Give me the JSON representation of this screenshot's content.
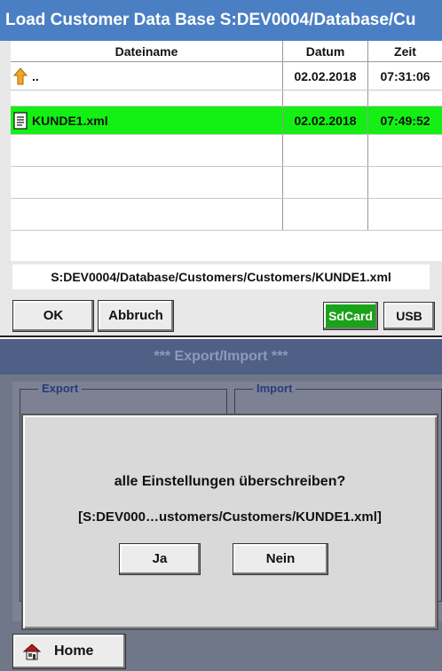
{
  "file_dialog": {
    "title": "Load Customer Data Base S:DEV0004/Database/Cu",
    "columns": {
      "name": "Dateiname",
      "date": "Datum",
      "time": "Zeit"
    },
    "rows": [
      {
        "icon": "folder-up-icon",
        "name": "..",
        "date": "02.02.2018",
        "time": "07:31:06",
        "selected": false
      },
      {
        "icon": "file-icon",
        "name": "KUNDE1.xml",
        "date": "02.02.2018",
        "time": "07:49:52",
        "selected": true
      }
    ],
    "path": "S:DEV0004/Database/Customers/Customers/KUNDE1.xml",
    "buttons": {
      "ok": "OK",
      "cancel": "Abbruch",
      "sdcard": "SdCard",
      "usb": "USB"
    },
    "colors": {
      "title_bg": "#4a7fc4",
      "selected_row": "#14f014",
      "sdcard_active": "#1aa21a"
    }
  },
  "export_import": {
    "title": "***  Export/Import  ***",
    "groups": {
      "export": "Export",
      "import": "Import"
    },
    "confirm": {
      "question": "alle Einstellungen überschreiben?",
      "path": "[S:DEV000…ustomers/Customers/KUNDE1.xml]",
      "yes": "Ja",
      "no": "Nein"
    },
    "home": {
      "label": "Home",
      "icon": "home-icon"
    }
  }
}
